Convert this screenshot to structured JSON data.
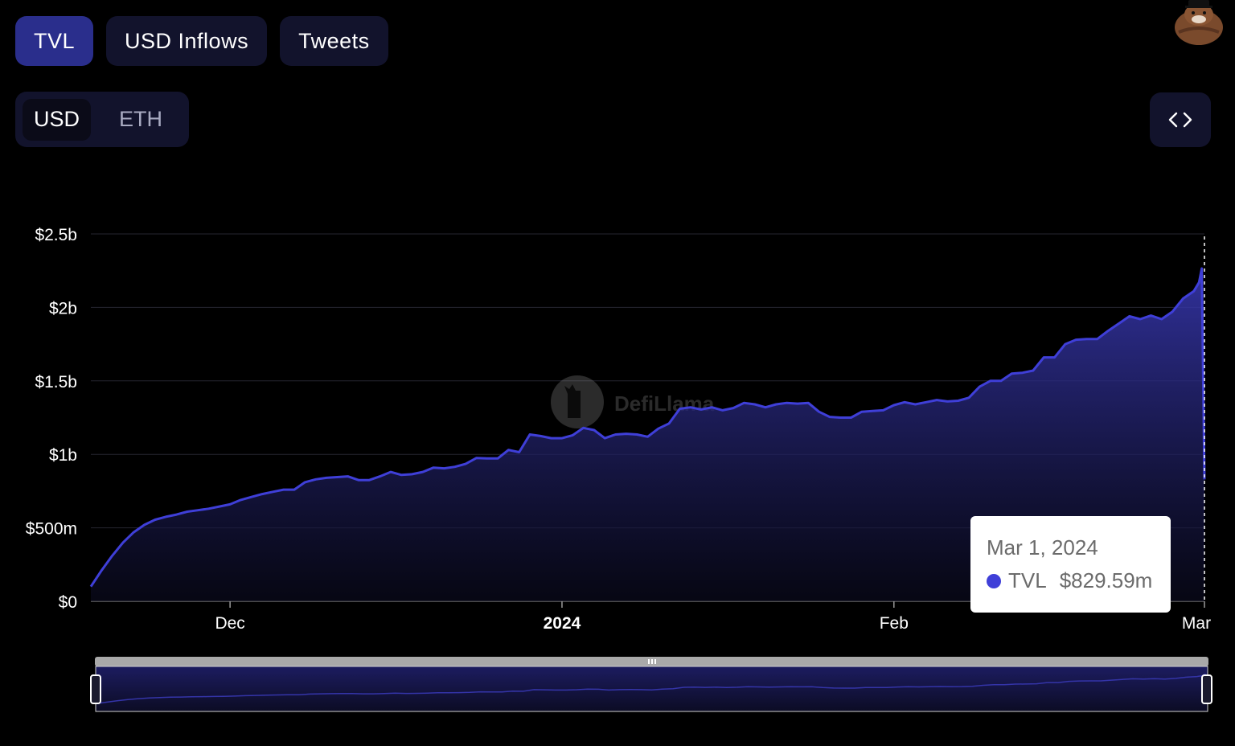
{
  "tabs": [
    {
      "label": "TVL",
      "active": true
    },
    {
      "label": "USD Inflows",
      "active": false
    },
    {
      "label": "Tweets",
      "active": false
    }
  ],
  "denomination": {
    "options": [
      "USD",
      "ETH"
    ],
    "selected": "USD"
  },
  "embed_icon": "code-brackets-icon",
  "watermark": "DefiLlama",
  "tooltip": {
    "date": "Mar 1, 2024",
    "series": "TVL",
    "value": "$829.59m"
  },
  "colors": {
    "accent": "#3f3fd8",
    "tab_active": "#2a2e8c",
    "panel": "#12132c"
  },
  "chart_data": {
    "type": "area",
    "title": "",
    "xlabel": "",
    "ylabel": "",
    "ylim": [
      0,
      2500000000
    ],
    "y_ticks": [
      {
        "value": 0,
        "label": "$0"
      },
      {
        "value": 500000000,
        "label": "$500m"
      },
      {
        "value": 1000000000,
        "label": "$1b"
      },
      {
        "value": 1500000000,
        "label": "$1.5b"
      },
      {
        "value": 2000000000,
        "label": "$2b"
      },
      {
        "value": 2500000000,
        "label": "$2.5b"
      }
    ],
    "x_range": [
      "2023-11-18",
      "2024-03-01"
    ],
    "x_ticks": [
      {
        "date": "2023-12-01",
        "label": "Dec",
        "bold": false
      },
      {
        "date": "2024-01-01",
        "label": "2024",
        "bold": true
      },
      {
        "date": "2024-02-01",
        "label": "Feb",
        "bold": false
      },
      {
        "date": "2024-03-01",
        "label": "Mar",
        "bold": false
      }
    ],
    "grid": true,
    "series": [
      {
        "name": "TVL",
        "color": "#3f3fd8",
        "points": [
          [
            "2023-11-18",
            100000000
          ],
          [
            "2023-11-19",
            210000000
          ],
          [
            "2023-11-20",
            310000000
          ],
          [
            "2023-11-21",
            400000000
          ],
          [
            "2023-11-22",
            470000000
          ],
          [
            "2023-11-23",
            520000000
          ],
          [
            "2023-11-24",
            555000000
          ],
          [
            "2023-11-25",
            575000000
          ],
          [
            "2023-11-26",
            590000000
          ],
          [
            "2023-11-27",
            610000000
          ],
          [
            "2023-11-28",
            620000000
          ],
          [
            "2023-11-29",
            630000000
          ],
          [
            "2023-11-30",
            645000000
          ],
          [
            "2023-12-01",
            660000000
          ],
          [
            "2023-12-02",
            690000000
          ],
          [
            "2023-12-03",
            710000000
          ],
          [
            "2023-12-04",
            730000000
          ],
          [
            "2023-12-05",
            745000000
          ],
          [
            "2023-12-06",
            760000000
          ],
          [
            "2023-12-07",
            760000000
          ],
          [
            "2023-12-08",
            810000000
          ],
          [
            "2023-12-09",
            830000000
          ],
          [
            "2023-12-10",
            840000000
          ],
          [
            "2023-12-11",
            845000000
          ],
          [
            "2023-12-12",
            850000000
          ],
          [
            "2023-12-13",
            825000000
          ],
          [
            "2023-12-14",
            825000000
          ],
          [
            "2023-12-15",
            850000000
          ],
          [
            "2023-12-16",
            880000000
          ],
          [
            "2023-12-17",
            860000000
          ],
          [
            "2023-12-18",
            865000000
          ],
          [
            "2023-12-19",
            880000000
          ],
          [
            "2023-12-20",
            910000000
          ],
          [
            "2023-12-21",
            905000000
          ],
          [
            "2023-12-22",
            915000000
          ],
          [
            "2023-12-23",
            935000000
          ],
          [
            "2023-12-24",
            975000000
          ],
          [
            "2023-12-25",
            972000000
          ],
          [
            "2023-12-26",
            972000000
          ],
          [
            "2023-12-27",
            1030000000
          ],
          [
            "2023-12-28",
            1015000000
          ],
          [
            "2023-12-29",
            1135000000
          ],
          [
            "2023-12-30",
            1125000000
          ],
          [
            "2023-12-31",
            1110000000
          ],
          [
            "2024-01-01",
            1110000000
          ],
          [
            "2024-01-02",
            1130000000
          ],
          [
            "2024-01-03",
            1180000000
          ],
          [
            "2024-01-04",
            1165000000
          ],
          [
            "2024-01-05",
            1110000000
          ],
          [
            "2024-01-06",
            1135000000
          ],
          [
            "2024-01-07",
            1140000000
          ],
          [
            "2024-01-08",
            1135000000
          ],
          [
            "2024-01-09",
            1120000000
          ],
          [
            "2024-01-10",
            1175000000
          ],
          [
            "2024-01-11",
            1210000000
          ],
          [
            "2024-01-12",
            1310000000
          ],
          [
            "2024-01-13",
            1320000000
          ],
          [
            "2024-01-14",
            1305000000
          ],
          [
            "2024-01-15",
            1320000000
          ],
          [
            "2024-01-16",
            1300000000
          ],
          [
            "2024-01-17",
            1315000000
          ],
          [
            "2024-01-18",
            1350000000
          ],
          [
            "2024-01-19",
            1340000000
          ],
          [
            "2024-01-20",
            1320000000
          ],
          [
            "2024-01-21",
            1340000000
          ],
          [
            "2024-01-22",
            1350000000
          ],
          [
            "2024-01-23",
            1345000000
          ],
          [
            "2024-01-24",
            1350000000
          ],
          [
            "2024-01-25",
            1290000000
          ],
          [
            "2024-01-26",
            1255000000
          ],
          [
            "2024-01-27",
            1250000000
          ],
          [
            "2024-01-28",
            1250000000
          ],
          [
            "2024-01-29",
            1290000000
          ],
          [
            "2024-01-30",
            1295000000
          ],
          [
            "2024-01-31",
            1300000000
          ],
          [
            "2024-02-01",
            1335000000
          ],
          [
            "2024-02-02",
            1355000000
          ],
          [
            "2024-02-03",
            1340000000
          ],
          [
            "2024-02-04",
            1355000000
          ],
          [
            "2024-02-05",
            1370000000
          ],
          [
            "2024-02-06",
            1360000000
          ],
          [
            "2024-02-07",
            1365000000
          ],
          [
            "2024-02-08",
            1385000000
          ],
          [
            "2024-02-09",
            1460000000
          ],
          [
            "2024-02-10",
            1500000000
          ],
          [
            "2024-02-11",
            1500000000
          ],
          [
            "2024-02-12",
            1550000000
          ],
          [
            "2024-02-13",
            1555000000
          ],
          [
            "2024-02-14",
            1570000000
          ],
          [
            "2024-02-15",
            1660000000
          ],
          [
            "2024-02-16",
            1660000000
          ],
          [
            "2024-02-17",
            1750000000
          ],
          [
            "2024-02-18",
            1780000000
          ],
          [
            "2024-02-19",
            1785000000
          ],
          [
            "2024-02-20",
            1785000000
          ],
          [
            "2024-02-21",
            1840000000
          ],
          [
            "2024-02-22",
            1890000000
          ],
          [
            "2024-02-23",
            1940000000
          ],
          [
            "2024-02-24",
            1920000000
          ],
          [
            "2024-02-25",
            1945000000
          ],
          [
            "2024-02-26",
            1920000000
          ],
          [
            "2024-02-27",
            1970000000
          ],
          [
            "2024-02-28",
            2060000000
          ],
          [
            "2024-02-29",
            2110000000
          ],
          [
            "2024-02-29T12:00",
            2170000000
          ],
          [
            "2024-02-29T18:00",
            2265000000
          ],
          [
            "2024-03-01",
            829590000
          ]
        ]
      }
    ],
    "tooltip_point": {
      "date": "2024-03-01",
      "value": 829590000
    }
  }
}
